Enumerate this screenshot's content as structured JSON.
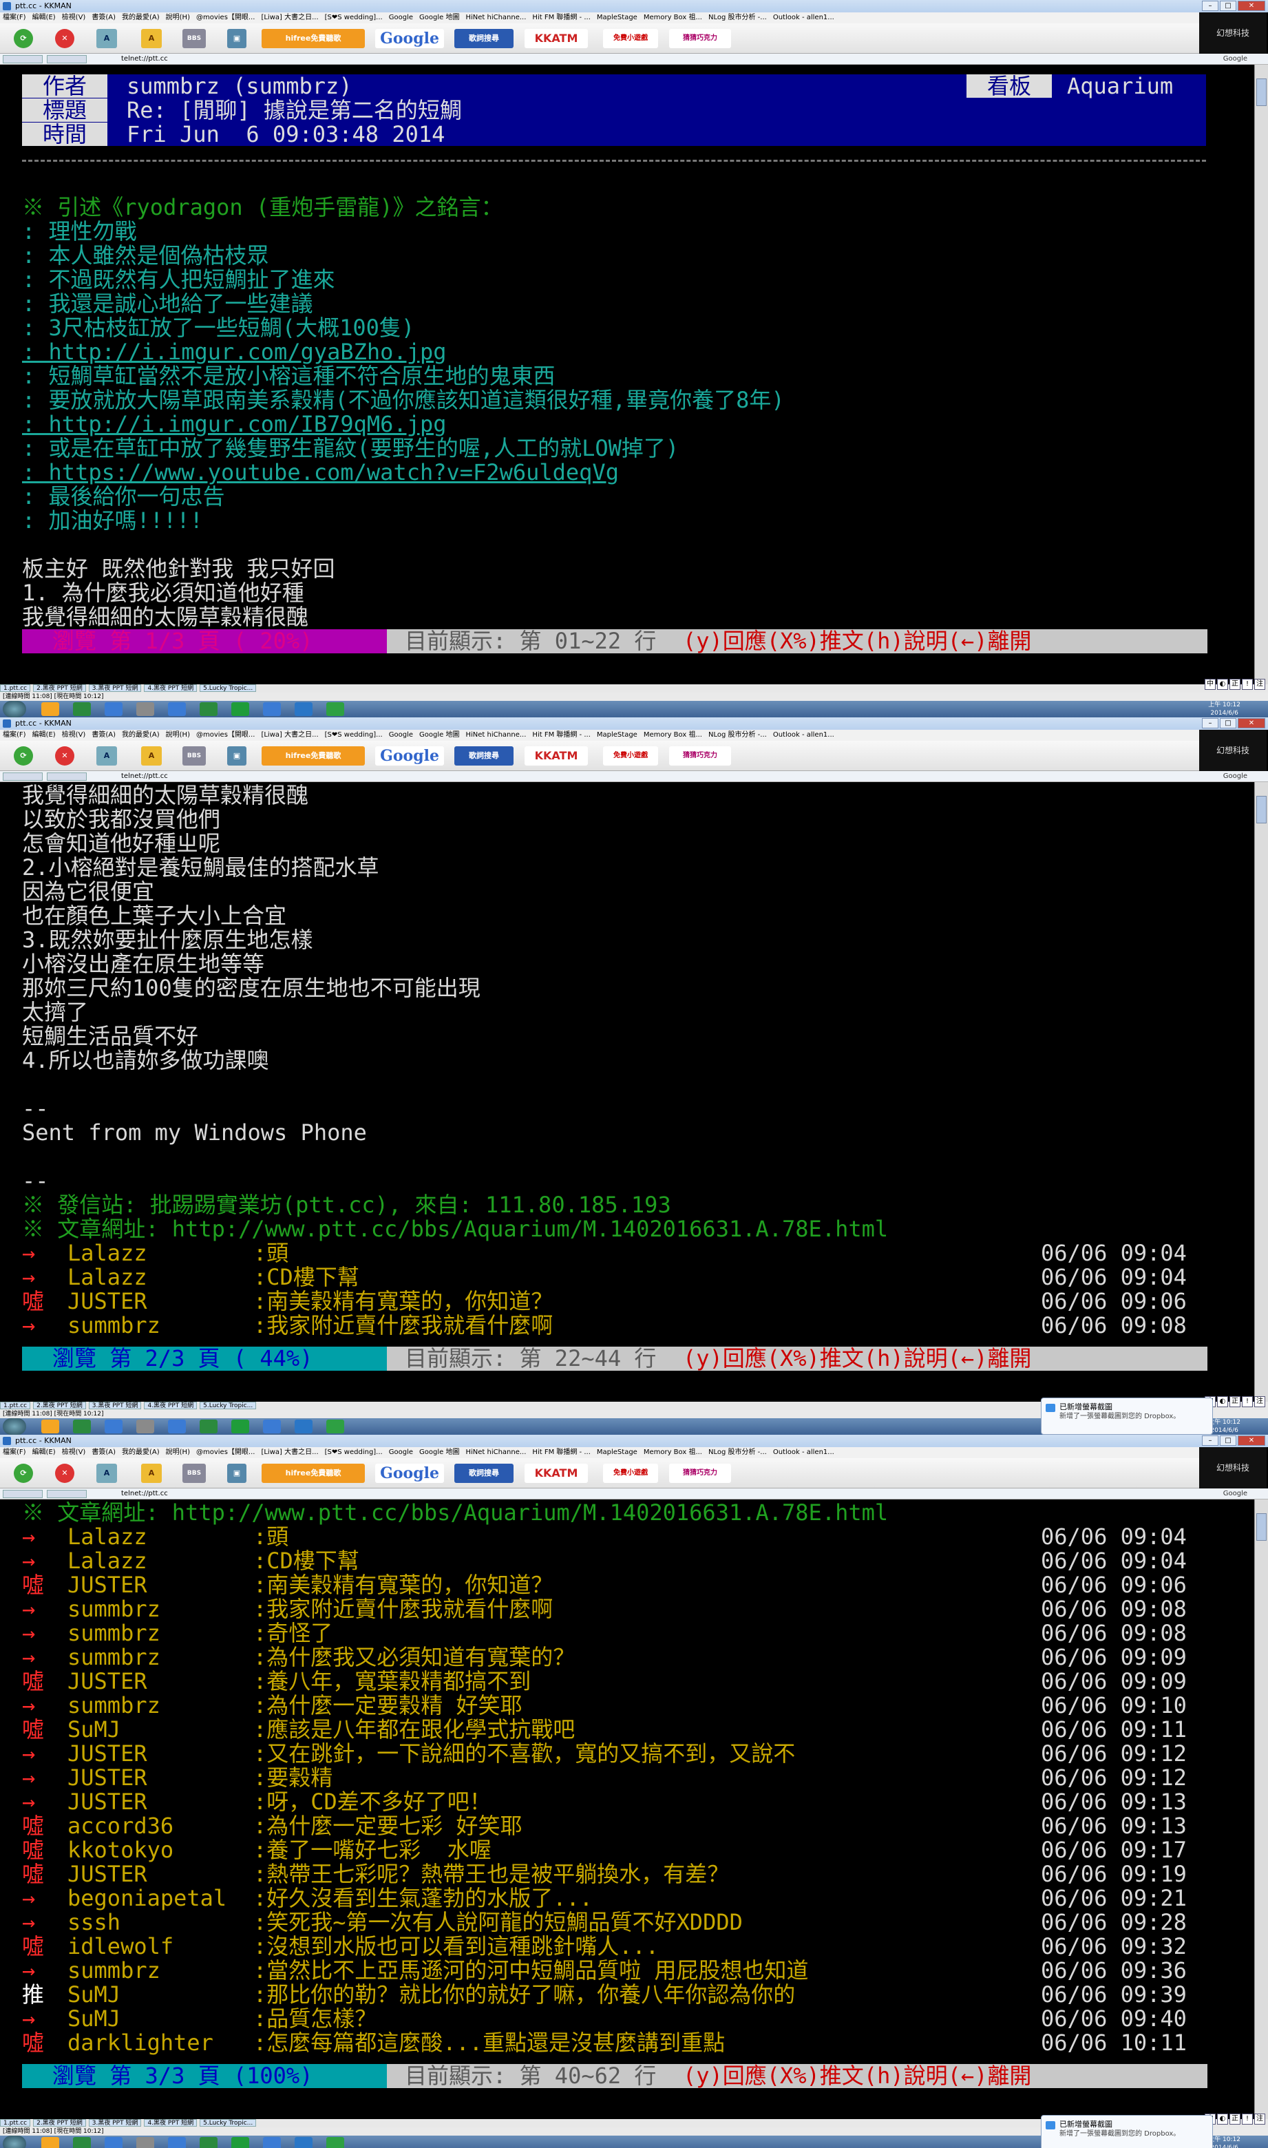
{
  "window": {
    "title": "ptt.cc - KKMAN",
    "address": "telnet://ptt.cc",
    "google_label": "Google"
  },
  "menu": [
    "檔案(F)",
    "編輯(E)",
    "檢視(V)",
    "書簽(A)",
    "我的最愛(A)",
    "說明(H)",
    "@movies【開眼...",
    "[Liwa] 大書之日...",
    "[S❤S wedding]...",
    "Google",
    "Google 地圖",
    "HiNet hiChanne...",
    "Hit FM 聯播網 - ...",
    "MapleStage",
    "Memory Box 祖...",
    "NLog 股市分析 -...",
    "Outlook - allen1..."
  ],
  "toolbar": {
    "hifree": "hifree免費聽歌",
    "google": "Google",
    "search": "歌詞搜尋",
    "kkatm": "KKATM",
    "game": "免費小遊戲",
    "quiz": "猜猜巧克力"
  },
  "brand_logo": "幻想科技",
  "article": {
    "author_label": "作者",
    "author": "summbrz (summbrz)",
    "board_label": "看板",
    "board": "Aquarium",
    "title_label": "標題",
    "title": "Re: [閒聊] 據說是第二名的短鯛",
    "time_label": "時間",
    "time": "Fri Jun  6 09:03:48 2014",
    "quote_header": "※ 引述《ryodragon (重炮手雷龍)》之銘言：",
    "quotes": [
      ": 理性勿戰",
      ": 本人雖然是個偽枯枝眾",
      ": 不過既然有人把短鯛扯了進來",
      ": 我還是誠心地給了一些建議",
      ": 3尺枯枝缸放了一些短鯛(大概100隻)",
      ": http://i.imgur.com/gyaBZho.jpg",
      ": 短鯛草缸當然不是放小榕這種不符合原生地的鬼東西",
      ": 要放就放大陽草跟南美系穀精(不過你應該知道這類很好種,畢竟你養了8年)",
      ": http://i.imgur.com/IB79qM6.jpg",
      ": 或是在草缸中放了幾隻野生龍紋(要野生的喔,人工的就LOW掉了)",
      ": https://www.youtube.com/watch?v=F2w6uldeqVg",
      ": 最後給你一句忠告",
      ": 加油好嗎!!!!!"
    ],
    "body1": [
      "板主好 既然他針對我 我只好回",
      "1. 為什麼我必須知道他好種",
      "我覺得細細的太陽草穀精很醜"
    ],
    "body2": [
      "我覺得細細的太陽草穀精很醜",
      "以致於我都沒買他們",
      "怎會知道他好種ㄓ呢",
      "2.小榕絕對是養短鯛最佳的搭配水草",
      "因為它很便宜",
      "也在顏色上葉子大小上合宜",
      "3.既然妳要扯什麼原生地怎樣",
      "小榕沒出產在原生地等等",
      "那妳三尺約100隻的密度在原生地也不可能出現",
      "太擠了",
      "短鯛生活品質不好",
      "4.所以也請妳多做功課噢",
      "",
      "--",
      "Sent from my Windows Phone",
      "",
      "--"
    ],
    "sig1": "※ 發信站: 批踢踢實業坊(ptt.cc), 來自: 111.80.185.193",
    "sig2": "※ 文章網址: http://www.ptt.cc/bbs/Aquarium/M.1402016631.A.78E.html"
  },
  "pushes": [
    {
      "tag": "→",
      "id": "Lalazz",
      "c": ":頭",
      "t": "06/06 09:04"
    },
    {
      "tag": "→",
      "id": "Lalazz",
      "c": ":CD樓下幫",
      "t": "06/06 09:04"
    },
    {
      "tag": "噓",
      "id": "JUSTER",
      "c": ":南美穀精有寬葉的，你知道？",
      "t": "06/06 09:06"
    },
    {
      "tag": "→",
      "id": "summbrz",
      "c": ":我家附近賣什麼我就看什麼啊",
      "t": "06/06 09:08"
    },
    {
      "tag": "→",
      "id": "summbrz",
      "c": ":奇怪了",
      "t": "06/06 09:08"
    },
    {
      "tag": "→",
      "id": "summbrz",
      "c": ":為什麼我又必須知道有寬葉的？",
      "t": "06/06 09:09"
    },
    {
      "tag": "噓",
      "id": "JUSTER",
      "c": ":養八年，寬葉穀精都搞不到",
      "t": "06/06 09:09"
    },
    {
      "tag": "→",
      "id": "summbrz",
      "c": ":為什麼一定要穀精 好笑耶",
      "t": "06/06 09:10"
    },
    {
      "tag": "噓",
      "id": "SuMJ",
      "c": ":應該是八年都在跟化學式抗戰吧",
      "t": "06/06 09:11"
    },
    {
      "tag": "→",
      "id": "JUSTER",
      "c": ":又在跳針，一下說細的不喜歡，寬的又搞不到，又說不",
      "t": "06/06 09:12"
    },
    {
      "tag": "→",
      "id": "JUSTER",
      "c": ":要穀精",
      "t": "06/06 09:12"
    },
    {
      "tag": "→",
      "id": "JUSTER",
      "c": ":呀，CD差不多好了吧！",
      "t": "06/06 09:13"
    },
    {
      "tag": "噓",
      "id": "accord36",
      "c": ":為什麼一定要七彩 好笑耶",
      "t": "06/06 09:13"
    },
    {
      "tag": "噓",
      "id": "kkotokyo",
      "c": ":養了一嘴好七彩  水喔",
      "t": "06/06 09:17"
    },
    {
      "tag": "噓",
      "id": "JUSTER",
      "c": ":熱帶王七彩呢？熱帶王也是被平躺換水，有差？",
      "t": "06/06 09:19"
    },
    {
      "tag": "→",
      "id": "begoniapetal",
      "c": ":好久沒看到生氣蓬勃的水版了...",
      "t": "06/06 09:21"
    },
    {
      "tag": "→",
      "id": "sssh",
      "c": ":笑死我~第一次有人說阿龍的短鯛品質不好XDDDD",
      "t": "06/06 09:28"
    },
    {
      "tag": "噓",
      "id": "idlewolf",
      "c": ":沒想到水版也可以看到這種跳針嘴人...",
      "t": "06/06 09:32"
    },
    {
      "tag": "→",
      "id": "summbrz",
      "c": ":當然比不上亞馬遜河的河中短鯛品質啦 用屁股想也知道",
      "t": "06/06 09:36"
    },
    {
      "tag": "推",
      "id": "SuMJ",
      "c": ":那比你的勒？就比你的就好了嘛，你養八年你認為你的",
      "t": "06/06 09:39"
    },
    {
      "tag": "→",
      "id": "SuMJ",
      "c": ":品質怎樣？",
      "t": "06/06 09:40"
    },
    {
      "tag": "噓",
      "id": "darklighter",
      "c": ":怎麼每篇都這麼酸...重點還是沒甚麼講到重點",
      "t": "06/06 10:11"
    }
  ],
  "status": [
    {
      "page": "瀏覽 第 1/3 頁 ( 20%)",
      "range": "目前顯示: 第 01~22 行",
      "keys": "(y)回應(X%)推文(h)說明(←)離開"
    },
    {
      "page": "瀏覽 第 2/3 頁 ( 44%)",
      "range": "目前顯示: 第 22~44 行",
      "keys": "(y)回應(X%)推文(h)說明(←)離開"
    },
    {
      "page": "瀏覽 第 3/3 頁 (100%)",
      "range": "目前顯示: 第 40~62 行",
      "keys": "(y)回應(X%)推文(h)說明(←)離開"
    }
  ],
  "tabs": [
    "1.ptt.cc",
    "2.黑夜 PPT 短網",
    "3.黑夜 PPT 短網",
    "4.黑夜 PPT 短網",
    "5.Lucky Tropic..."
  ],
  "statusbar": "[連線時間 11:08] [現在時間 10:12]",
  "clock": {
    "time": "上午 10:12",
    "date": "2014/6/6"
  },
  "toast": {
    "title": "已新增螢幕截圖",
    "body": "新增了一張螢幕截圖到您的 Dropbox。"
  }
}
